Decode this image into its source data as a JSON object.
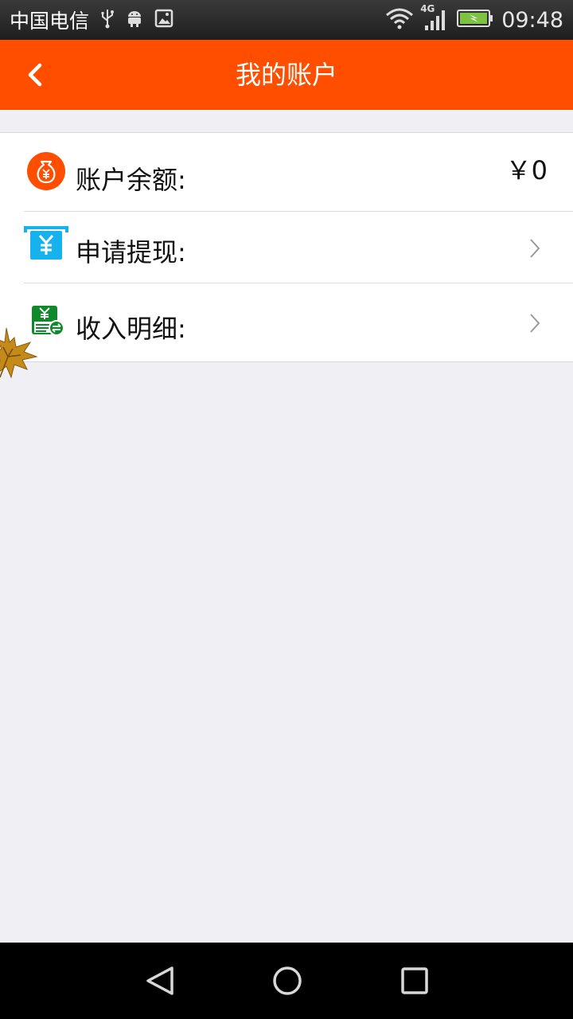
{
  "status_bar": {
    "carrier": "中国电信",
    "network": "4G",
    "time": "09:48",
    "icons": [
      "usb-icon",
      "android-icon",
      "image-icon",
      "wifi-icon",
      "signal-icon",
      "battery-charging-icon"
    ]
  },
  "app_bar": {
    "title": "我的账户",
    "color": "#ff4e00",
    "back_icon": "chevron-left-icon"
  },
  "account": {
    "balance": {
      "label": "账户余额:",
      "value": "￥0",
      "icon": "money-bag-icon",
      "icon_color": "#ff4e00"
    },
    "withdraw": {
      "label": "申请提现:",
      "icon": "withdraw-icon",
      "icon_color": "#16b2ee"
    },
    "income": {
      "label": "收入明细:",
      "icon": "income-detail-icon",
      "icon_color": "#0f8a2a"
    }
  },
  "decoration": {
    "icon": "maple-leaf-icon"
  },
  "nav_bar": {
    "icons": [
      "back-triangle-icon",
      "home-circle-icon",
      "recents-square-icon"
    ]
  }
}
